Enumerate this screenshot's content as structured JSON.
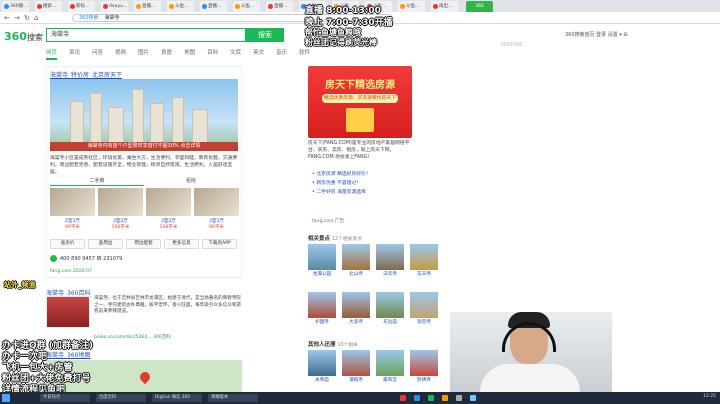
{
  "browser": {
    "tabs": [
      {
        "label": "360搜…",
        "color": "#2a8ef0"
      },
      {
        "label": "搜索…",
        "color": "#e33"
      },
      {
        "label": "新标…",
        "color": "#e33"
      },
      {
        "label": "douyu…",
        "color": "#e33"
      },
      {
        "label": "直播…",
        "color": "#f90"
      },
      {
        "label": "斗鱼…",
        "color": "#f90"
      },
      {
        "label": "直播…",
        "color": "#2a8ef0"
      },
      {
        "label": "斗鱼…",
        "color": "#f90"
      },
      {
        "label": "直播…",
        "color": "#e33"
      },
      {
        "label": "斗鱼…",
        "color": "#2a8ef0"
      },
      {
        "label": "斗鱼…",
        "color": "#f90"
      },
      {
        "label": "斗鱼…",
        "color": "#e33"
      },
      {
        "label": "斗鱼…",
        "color": "#f90"
      },
      {
        "label": "再出…",
        "color": "#e33"
      }
    ],
    "active_tab_label": "360",
    "url_prefix": "360搜索",
    "url": "海棠寺"
  },
  "search": {
    "logo": "360",
    "logo_suffix": "搜索",
    "query": "海棠寺",
    "button": "搜索",
    "top_right": "360搜索首页  登录  设置 ▾  ⊞",
    "nav": [
      "网页",
      "资讯",
      "问答",
      "视频",
      "图片",
      "良医",
      "地图",
      "百科",
      "文库",
      "英文",
      "音乐",
      "软件"
    ],
    "nav_active": 0,
    "counter": "2863566"
  },
  "result1": {
    "title": "海棠寺_特价房_北京房天下",
    "banner_caption": "海棠寺内有首个户型限时享首付不超30% 点击详情",
    "desc": "海棠寺小区是成熟社区，环境优美，乘坐大方，生活便利，邻里和睦，教育优越，交通便利，周边配套完善，配套设施齐全，物业管理，毗邻自然景观，生活便利，人居舒适宜居。",
    "tabs": [
      "二手房",
      "租房"
    ],
    "rooms": [
      {
        "name": "2室1厅",
        "price": "89平米"
      },
      {
        "name": "3室2厅",
        "price": "106平米"
      },
      {
        "name": "3室2厅",
        "price": "108平米"
      },
      {
        "name": "3室1厅",
        "price": "96平米"
      }
    ],
    "buttons": [
      "查房价",
      "查周边",
      "周边配套",
      "更多信息",
      "下载房APP"
    ],
    "phone": "400 890 9457 转 231079",
    "source": "fang.com  2020.07"
  },
  "result2": {
    "title": "海棠寺_360百科",
    "desc": "海棠寺，位于吉林省吉林市龙潭区，始建于清代，是当地著名的佛教寺院之一。寺内建筑古朴典雅，殿宇宏伟，香火旺盛，每年吸引众多信众和游客前来参拜游览。",
    "source": "baike.so.com/doc/5364...  360百科"
  },
  "result3": {
    "title": "海棠寺_360地图"
  },
  "ad": {
    "title": "房天下精选房源",
    "subtitle": "精选优质房源，买房就要找房天下",
    "desc": "房天下(FANG.COM)是专业的房地产家居网络平台，买房、卖房、租房，就上房天下网，FANG.COM,你会爱上FANG!",
    "links": [
      "• 北京房源 精选好房好价！",
      "• 新房优惠 不容错过！",
      "• 二手好房 海量房源选择"
    ],
    "source": "fang.com  广告"
  },
  "related": {
    "heading": "相关景点",
    "more": "12个相关景点",
    "items": [
      {
        "name": "龙潭公园",
        "color": "#5b8aa3"
      },
      {
        "name": "北山寺",
        "color": "#a86f3d"
      },
      {
        "name": "法华寺",
        "color": "#7f6a4c"
      },
      {
        "name": "玄天寺",
        "color": "#c49a42"
      },
      {
        "name": "护国寺",
        "color": "#b04a3a"
      },
      {
        "name": "大悲寺",
        "color": "#9c5a32"
      },
      {
        "name": "东岳庙",
        "color": "#6f8a4b"
      },
      {
        "name": "观音寺",
        "color": "#c4a070"
      }
    ]
  },
  "others": {
    "heading": "其他人还搜",
    "more": "10个相关",
    "items": [
      {
        "name": "关帝庙",
        "color": "#3d6a8e"
      },
      {
        "name": "潭柘寺",
        "color": "#a8553d"
      },
      {
        "name": "雍和宫",
        "color": "#6aa35a"
      },
      {
        "name": "卧佛寺",
        "color": "#c9473a"
      }
    ]
  },
  "overlay": {
    "schedule1": "直播 8:00-13:00",
    "schedule2": "晚上 7:00-7:30开播",
    "notice1": "帮忙鱼塘鱼粮哦",
    "notice2": "粉丝团记得刷荧光棒",
    "chat_name": "站外_频道",
    "left_lines": [
      "办卡进Q群 (加群备注)",
      "办卡一次吧",
      "飞机一包大+房管",
      "粉丝团+大佬免费打号",
      "详情流程见鱼吧"
    ]
  },
  "taskbar": {
    "items": [
      "今日热点",
      "百度百科",
      "Digtion 微信 360",
      "荣耀版本"
    ],
    "clock": "12:25"
  }
}
